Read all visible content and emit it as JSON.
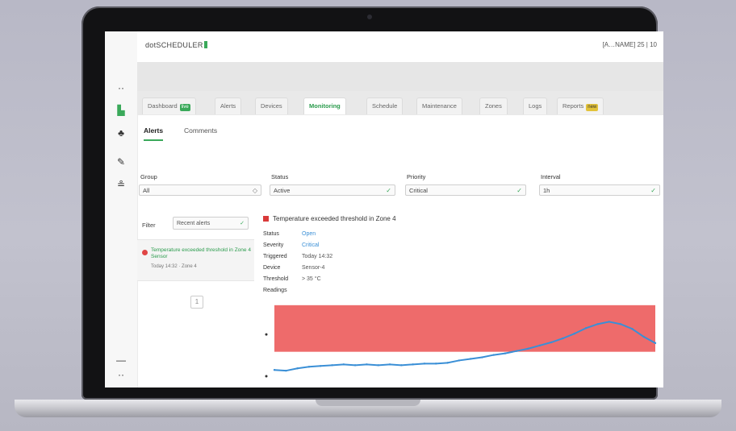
{
  "app": {
    "logo_text": "dotSCHEDULER",
    "top_right": "[A…NAME] 25 | 10"
  },
  "sidebar": {
    "items": [
      {
        "icon": "menu-dots-icon",
        "glyph": "··"
      },
      {
        "icon": "chart-icon",
        "glyph": "▙"
      },
      {
        "icon": "bell-icon",
        "glyph": "♣"
      },
      {
        "icon": "wrench-icon",
        "glyph": "✎"
      },
      {
        "icon": "users-icon",
        "glyph": "≗"
      },
      {
        "icon": "divider-icon",
        "glyph": "—"
      },
      {
        "icon": "more-icon",
        "glyph": "··"
      }
    ]
  },
  "tabs": [
    {
      "label": "Dashboard",
      "badge": "live",
      "active": false
    },
    {
      "label": "Alerts",
      "active": false
    },
    {
      "label": "Devices",
      "active": false
    },
    {
      "label": "Monitoring",
      "active": true
    },
    {
      "label": "Schedule",
      "active": false
    },
    {
      "label": "Maintenance",
      "active": false
    },
    {
      "label": "Zones",
      "active": false
    },
    {
      "label": "Logs",
      "active": false
    },
    {
      "label": "Reports",
      "badge": "new",
      "active": false
    }
  ],
  "subtabs": [
    {
      "label": "Alerts",
      "active": true
    },
    {
      "label": "Comments",
      "active": false
    }
  ],
  "filters": [
    {
      "label": "Group",
      "value": "All",
      "control": "caret"
    },
    {
      "label": "Status",
      "value": "Active",
      "control": "check"
    },
    {
      "label": "Priority",
      "value": "Critical",
      "control": "check"
    },
    {
      "label": "Interval",
      "value": "1h",
      "control": "check"
    }
  ],
  "left_panel": {
    "filter_label": "Filter",
    "filter_value": "Recent alerts",
    "item": {
      "title": "Temperature exceeded threshold in Zone 4 Sensor",
      "subtitle": "Today 14:32 · Zone 4"
    },
    "pager": "1"
  },
  "detail": {
    "title": "Temperature exceeded threshold in Zone 4",
    "rows": [
      {
        "key": "Status",
        "value": "Open",
        "link": true
      },
      {
        "key": "Severity",
        "value": "Critical",
        "link": true
      },
      {
        "key": "Triggered",
        "value": "Today 14:32",
        "link": false
      },
      {
        "key": "Device",
        "value": "Sensor-4",
        "link": false
      },
      {
        "key": "Threshold",
        "value": "> 35 °C",
        "link": false
      },
      {
        "key": "Readings",
        "value": "",
        "link": false
      }
    ]
  },
  "chart_data": {
    "type": "line",
    "series": [
      {
        "values": [
          0.1,
          0.09,
          0.12,
          0.14,
          0.15,
          0.16,
          0.17,
          0.16,
          0.17,
          0.16,
          0.17,
          0.16,
          0.17,
          0.18,
          0.18,
          0.19,
          0.22,
          0.24,
          0.26,
          0.29,
          0.31,
          0.34,
          0.37,
          0.41,
          0.45,
          0.5,
          0.56,
          0.63,
          0.68,
          0.71,
          0.68,
          0.62,
          0.52,
          0.44
        ]
      }
    ],
    "threshold_band": {
      "from": 0.33,
      "to": 0.92,
      "color": "#ee6b6b"
    },
    "line_color": "#3a8fd6",
    "ylim": [
      0,
      1
    ]
  }
}
